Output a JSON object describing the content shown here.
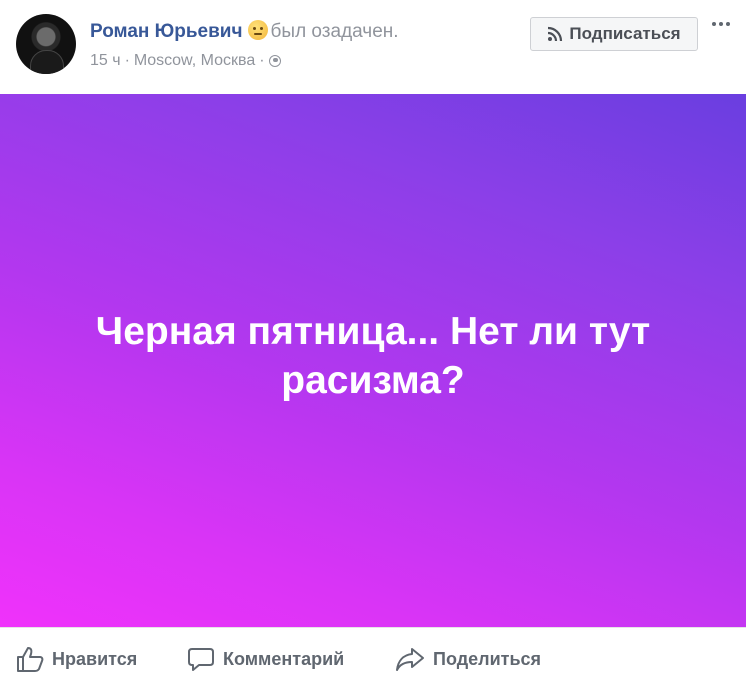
{
  "post": {
    "author": "Роман Юрьевич",
    "feeling": "был озадачен.",
    "time": "15 ч",
    "location": "Moscow, Москва",
    "follow_label": "Подписаться",
    "text": "Черная пятница... Нет ли тут расизма?",
    "privacy_icon": "globe-icon",
    "gradient_colors": [
      "#6a3ee0",
      "#f032fb"
    ]
  },
  "actions": {
    "like": "Нравится",
    "comment": "Комментарий",
    "share": "Поделиться"
  }
}
